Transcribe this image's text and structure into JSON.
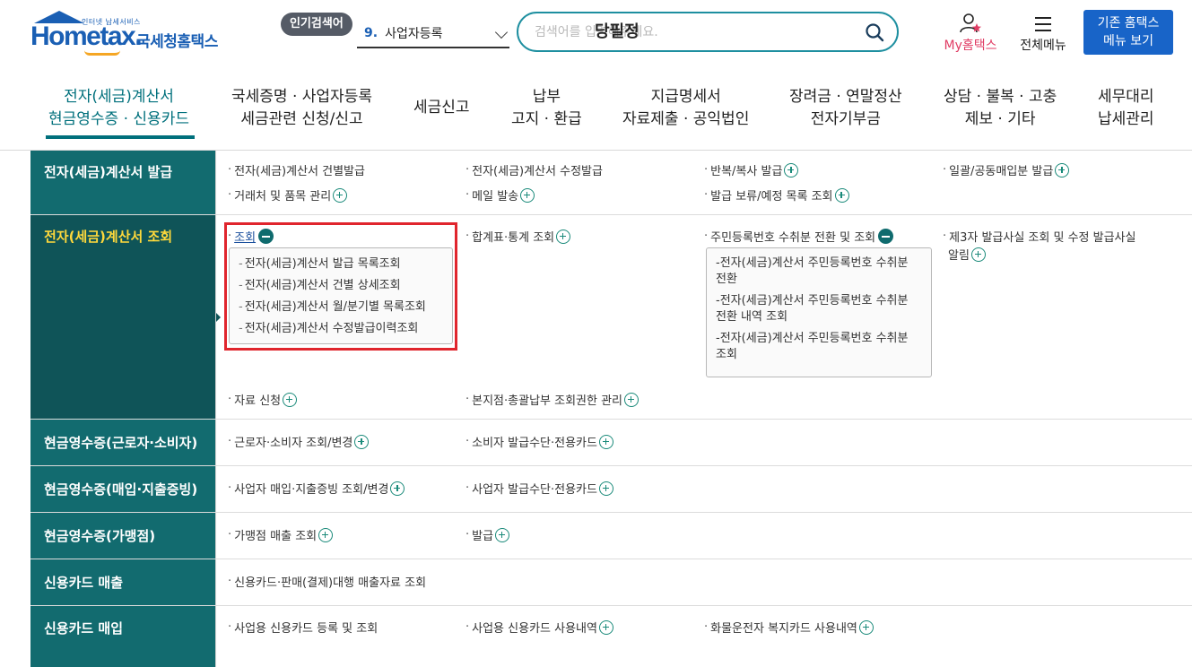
{
  "header": {
    "logo_small": "인터넷 납세서비스",
    "logo_main": "Hometax.",
    "logo_kr": "국세청홈택스",
    "popular_badge": "인기검색어",
    "popular_rank": "9.",
    "popular_item": "사업자등록",
    "search_placeholder": "검색어를 입력해주세요.",
    "search_overlay": "당필정",
    "my_label": "My홈택스",
    "all_menu_label": "전체메뉴",
    "legacy_line1": "기존 홈택스",
    "legacy_line2": "메뉴 보기"
  },
  "nav": [
    {
      "line1": "전자(세금)계산서",
      "line2": "현금영수증 · 신용카드"
    },
    {
      "line1": "국세증명 · 사업자등록",
      "line2": "세금관련 신청/신고"
    },
    {
      "line1": "세금신고",
      "line2": ""
    },
    {
      "line1": "납부",
      "line2": "고지 · 환급"
    },
    {
      "line1": "지급명세서",
      "line2": "자료제출 · 공익법인"
    },
    {
      "line1": "장려금 · 연말정산",
      "line2": "전자기부금"
    },
    {
      "line1": "상담 · 불복 · 고충",
      "line2": "제보 · 기타"
    },
    {
      "line1": "세무대리",
      "line2": "납세관리"
    }
  ],
  "rows": {
    "r1": {
      "head": "전자(세금)계산서 발급",
      "items": [
        "전자(세금)계산서 건별발급",
        "전자(세금)계산서 수정발급",
        "반복/복사 발급",
        "일괄/공동매입분 발급",
        "거래처 및 품목 관리",
        "메일 발송",
        "발급 보류/예정 목록 조회"
      ]
    },
    "r2": {
      "head": "전자(세금)계산서 조회",
      "items": [
        "조회",
        "합계표·통계 조회",
        "주민등록번호 수취분 전환 및 조회",
        "제3자 발급사실 조회 및 수정 발급사실",
        "알림",
        "자료 신청",
        "본지점·총괄납부 조회권한 관리"
      ],
      "sub1": [
        "전자(세금)계산서 발급 목록조회",
        "전자(세금)계산서 건별 상세조회",
        "전자(세금)계산서 월/분기별 목록조회",
        "전자(세금)계산서 수정발급이력조회"
      ],
      "sub2": [
        "전자(세금)계산서 주민등록번호 수취분 전환",
        "전자(세금)계산서 주민등록번호 수취분 전환 내역 조회",
        "전자(세금)계산서 주민등록번호 수취분 조회"
      ]
    },
    "r3": {
      "head": "현금영수증(근로자·소비자)",
      "items": [
        "근로자·소비자 조회/변경",
        "소비자 발급수단·전용카드"
      ]
    },
    "r4": {
      "head": "현금영수증(매입·지출증빙)",
      "items": [
        "사업자 매입·지출증빙 조회/변경",
        "사업자 발급수단·전용카드"
      ]
    },
    "r5": {
      "head": "현금영수증(가맹점)",
      "items": [
        "가맹점 매출 조회",
        "발급"
      ]
    },
    "r6": {
      "head": "신용카드 매출",
      "items": [
        "신용카드·판매(결제)대행 매출자료 조회"
      ]
    },
    "r7": {
      "head": "신용카드 매입",
      "items": [
        "사업용 신용카드 등록 및 조회",
        "사업용 신용카드 사용내역",
        "화물운전자 복지카드 사용내역"
      ]
    }
  },
  "colors": {
    "teal": "#126b6f",
    "teal_dark": "#0f5458",
    "highlight": "#ffd93b",
    "frame": "#e0252d",
    "brand_blue": "#1864c8"
  }
}
